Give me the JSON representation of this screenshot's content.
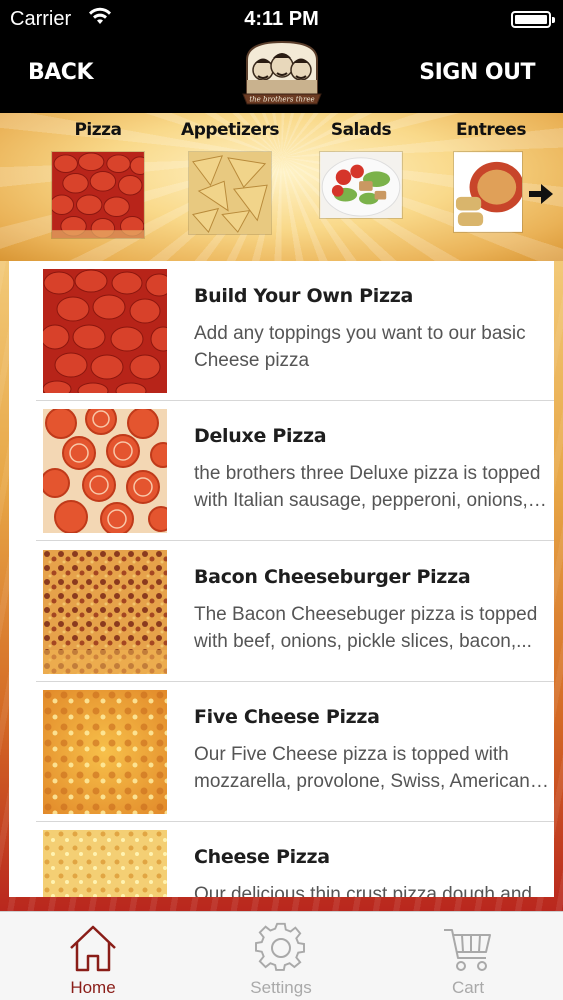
{
  "status_bar": {
    "carrier": "Carrier",
    "time": "4:11 PM"
  },
  "nav": {
    "back_label": "BACK",
    "signout_label": "SIGN OUT",
    "logo_text": "the brothers three"
  },
  "categories": [
    {
      "label": "Pizza",
      "image": "pepperoni-pizza"
    },
    {
      "label": "Appetizers",
      "image": "chips"
    },
    {
      "label": "Salads",
      "image": "salad"
    },
    {
      "label": "Entrees",
      "image": "lasagna"
    }
  ],
  "menu_items": [
    {
      "name": "Build Your Own Pizza",
      "description": "Add any toppings you want to our basic Cheese pizza",
      "image": "pepperoni-pizza"
    },
    {
      "name": "Deluxe Pizza",
      "description": "the brothers three Deluxe pizza is topped with Italian sausage, pepperoni, onions, m...",
      "image": "tomato-pizza"
    },
    {
      "name": "Bacon Cheeseburger Pizza",
      "description": "The Bacon Cheesebuger pizza is topped with beef, onions, pickle slices, bacon,...",
      "image": "bacon-pizza"
    },
    {
      "name": "Five Cheese Pizza",
      "description": "Our Five Cheese pizza is topped with mozzarella, provolone, Swiss, American an...",
      "image": "cheese-pizza"
    },
    {
      "name": "Cheese Pizza",
      "description": "Our delicious thin crust pizza dough and",
      "image": "cheese-pizza-light"
    }
  ],
  "tabs": [
    {
      "label": "Home",
      "icon": "home-icon",
      "active": true
    },
    {
      "label": "Settings",
      "icon": "gear-icon",
      "active": false
    },
    {
      "label": "Cart",
      "icon": "cart-icon",
      "active": false
    }
  ],
  "colors": {
    "accent": "#8a1d18",
    "inactive": "#a9a9a9",
    "nav_bg": "#000000"
  }
}
